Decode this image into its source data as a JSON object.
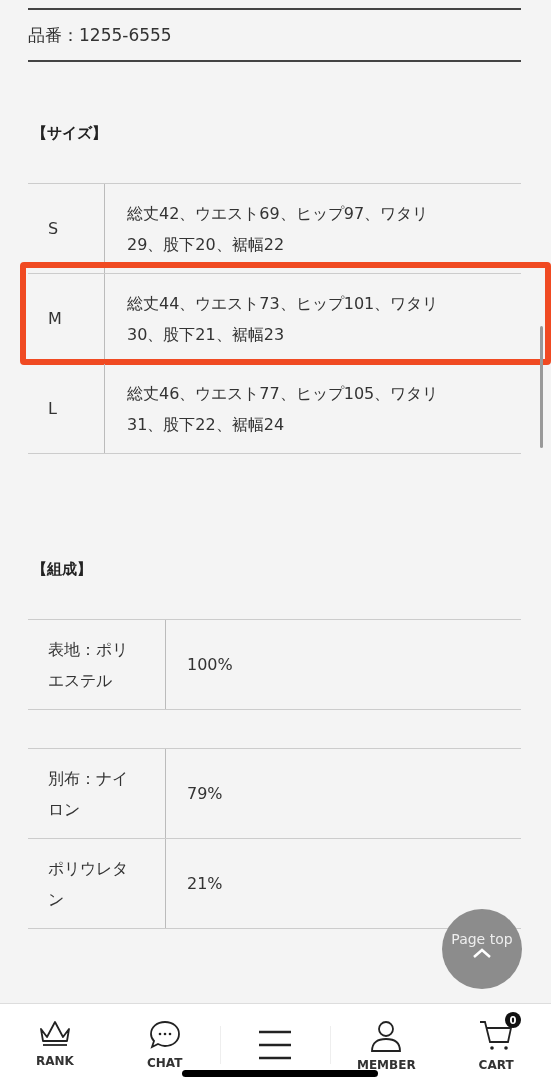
{
  "product_code": "品番：1255-6555",
  "size_section": {
    "heading": "【サイズ】",
    "rows": [
      {
        "size": "S",
        "measurements": "総丈42、ウエスト69、ヒップ97、ワタリ29、股下20、裾幅22",
        "marked": false
      },
      {
        "size": "M",
        "measurements": "総丈44、ウエスト73、ヒップ101、ワタリ30、股下21、裾幅23",
        "marked": true
      },
      {
        "size": "L",
        "measurements": "総丈46、ウエスト77、ヒップ105、ワタリ31、股下22、裾幅24",
        "marked": false
      }
    ]
  },
  "composition_section": {
    "heading": "【組成】",
    "tables": [
      [
        {
          "material": "表地：ポリエステル",
          "percent": "100%"
        }
      ],
      [
        {
          "material": "別布：ナイロン",
          "percent": "79%"
        },
        {
          "material": "ポリウレタン",
          "percent": "21%"
        }
      ]
    ]
  },
  "page_top": {
    "label": "Page top"
  },
  "bottom_nav": [
    {
      "kind": "rank",
      "label": "RANK"
    },
    {
      "kind": "chat",
      "label": "CHAT"
    },
    {
      "kind": "menu"
    },
    {
      "kind": "member",
      "label": "MEMBER"
    },
    {
      "kind": "cart",
      "label": "CART",
      "badge": "0"
    }
  ]
}
